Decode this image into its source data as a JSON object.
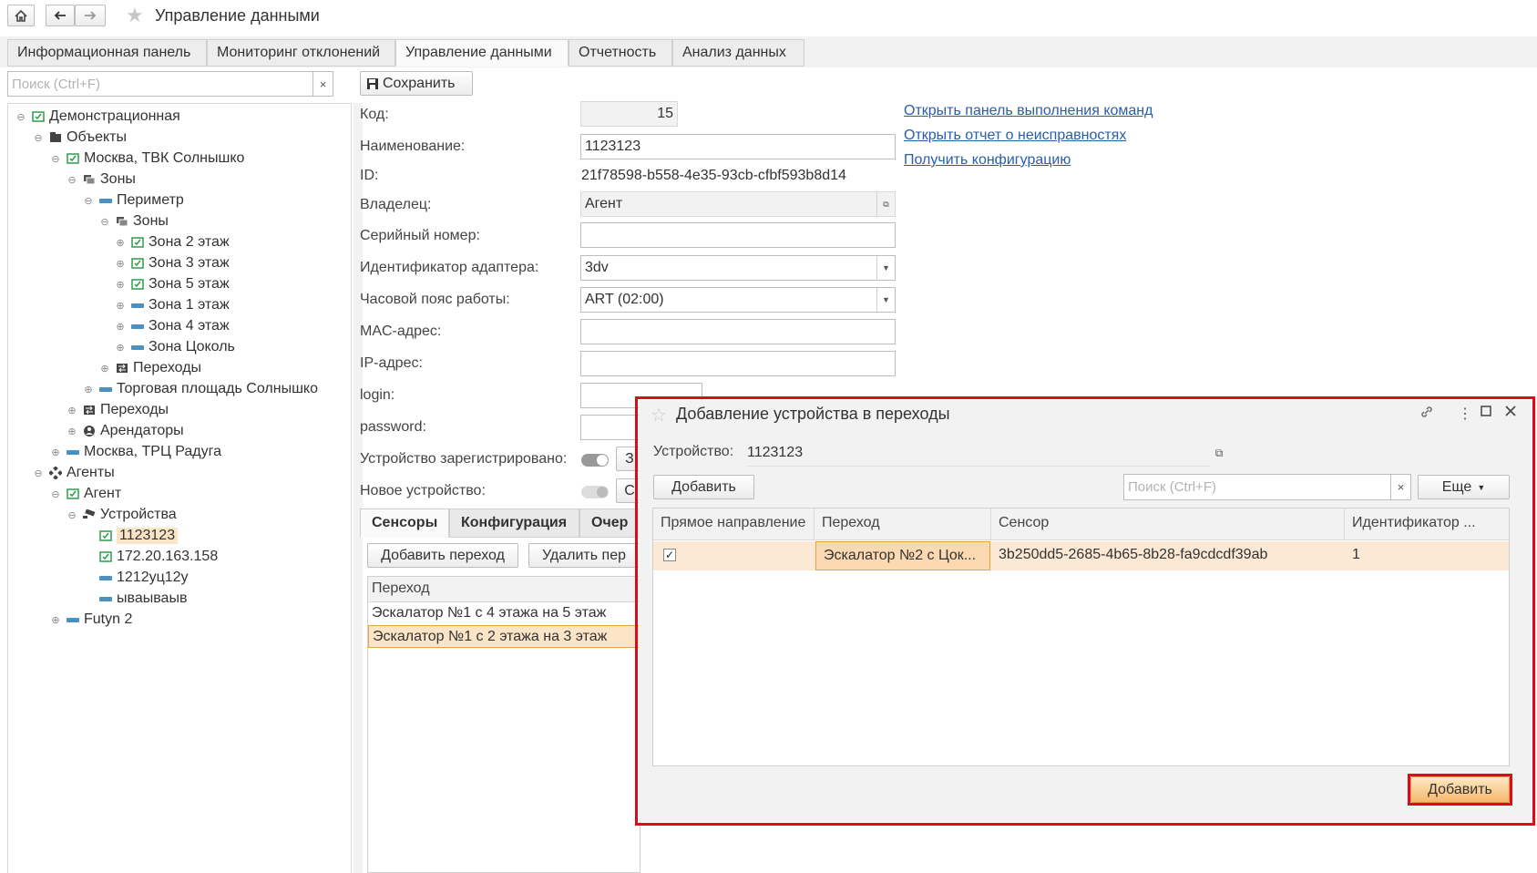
{
  "window": {
    "title": "Управление данными"
  },
  "tabs": [
    "Информационная панель",
    "Мониторинг отклонений",
    "Управление данными",
    "Отчетность",
    "Анализ данных"
  ],
  "left_search": {
    "placeholder": "Поиск (Ctrl+F)",
    "clear": "×"
  },
  "tree": [
    {
      "label": "Демонстрационная",
      "icon": "green-object-icon"
    },
    {
      "label": "Объекты",
      "icon": "folder-icon"
    },
    {
      "label": "Москва, ТВК Солнышко",
      "icon": "green-object-icon"
    },
    {
      "label": "Зоны",
      "icon": "zones-icon"
    },
    {
      "label": "Периметр",
      "icon": "dash-icon"
    },
    {
      "label": "Зоны",
      "icon": "zones-icon"
    },
    {
      "label": "Зона 2 этаж",
      "icon": "green-object-icon"
    },
    {
      "label": "Зона 3 этаж",
      "icon": "green-object-icon"
    },
    {
      "label": "Зона 5 этаж",
      "icon": "green-object-icon"
    },
    {
      "label": "Зона 1 этаж",
      "icon": "dash-icon"
    },
    {
      "label": "Зона 4 этаж",
      "icon": "dash-icon"
    },
    {
      "label": "Зона Цоколь",
      "icon": "dash-icon"
    },
    {
      "label": "Переходы",
      "icon": "transitions-icon"
    },
    {
      "label": "Торговая площадь Солнышко",
      "icon": "dash-icon"
    },
    {
      "label": "Переходы",
      "icon": "transitions-icon"
    },
    {
      "label": "Арендаторы",
      "icon": "person-icon"
    },
    {
      "label": "Москва, ТРЦ Радуга",
      "icon": "dash-icon"
    },
    {
      "label": "Агенты",
      "icon": "agents-icon"
    },
    {
      "label": "Агент",
      "icon": "green-object-icon"
    },
    {
      "label": "Устройства",
      "icon": "camera-icon"
    },
    {
      "label": "1123123",
      "icon": "green-object-icon"
    },
    {
      "label": "172.20.163.158",
      "icon": "green-object-icon"
    },
    {
      "label": "1212уц12у",
      "icon": "dash-icon"
    },
    {
      "label": "ываываыв",
      "icon": "dash-icon"
    },
    {
      "label": "Futyn 2",
      "icon": "dash-icon"
    }
  ],
  "form": {
    "save_label": "Сохранить",
    "code_label": "Код:",
    "code_value": "15",
    "name_label": "Наименование:",
    "name_value": "1123123",
    "id_label": "ID:",
    "id_value": "21f78598-b558-4e35-93cb-cfbf593b8d14",
    "owner_label": "Владелец:",
    "owner_value": "Агент",
    "serial_label": "Серийный номер:",
    "serial_value": "",
    "adapter_label": "Идентификатор адаптера:",
    "adapter_value": "3dv",
    "tz_label": "Часовой пояс работы:",
    "tz_value": "ART (02:00)",
    "mac_label": "MAC-адрес:",
    "mac_value": "",
    "ip_label": "IP-адрес:",
    "ip_value": "",
    "login_label": "login:",
    "login_value": "",
    "password_label": "password:",
    "password_value": "",
    "registered_label": "Устройство зарегистрировано:",
    "registered_btn": "З",
    "new_label": "Новое устройство:",
    "new_btn": "С"
  },
  "links": [
    "Открыть панель выполнения команд",
    "Открыть отчет о неисправностях",
    "Получить конфигурацию"
  ],
  "lower_tabs": [
    "Сенсоры",
    "Конфигурация",
    "Очер"
  ],
  "lower_buttons": {
    "add": "Добавить переход",
    "delete": "Удалить пер"
  },
  "lower_table": {
    "header": "Переход",
    "rows": [
      "Эскалатор №1 с 4 этажа на 5 этаж",
      "Эскалатор №1 с 2 этажа на 3 этаж"
    ]
  },
  "modal": {
    "title": "Добавление устройства в переходы",
    "device_label": "Устройство:",
    "device_value": "1123123",
    "add_label": "Добавить",
    "search_placeholder": "Поиск (Ctrl+F)",
    "search_clear": "×",
    "more_label": "Еще",
    "columns": [
      "Прямое направление",
      "Переход",
      "Сенсор",
      "Идентификатор ..."
    ],
    "rows": [
      {
        "direct": "✓",
        "transition": "Эскалатор №2 с Цок...",
        "sensor": "3b250dd5-2685-4b65-8b28-fa9cdcdf39ab",
        "ident": "1"
      }
    ],
    "submit_label": "Добавить"
  },
  "colors": {
    "accent_red": "#e0081b",
    "selection": "#fce4c7",
    "link": "#2a5ea8"
  }
}
